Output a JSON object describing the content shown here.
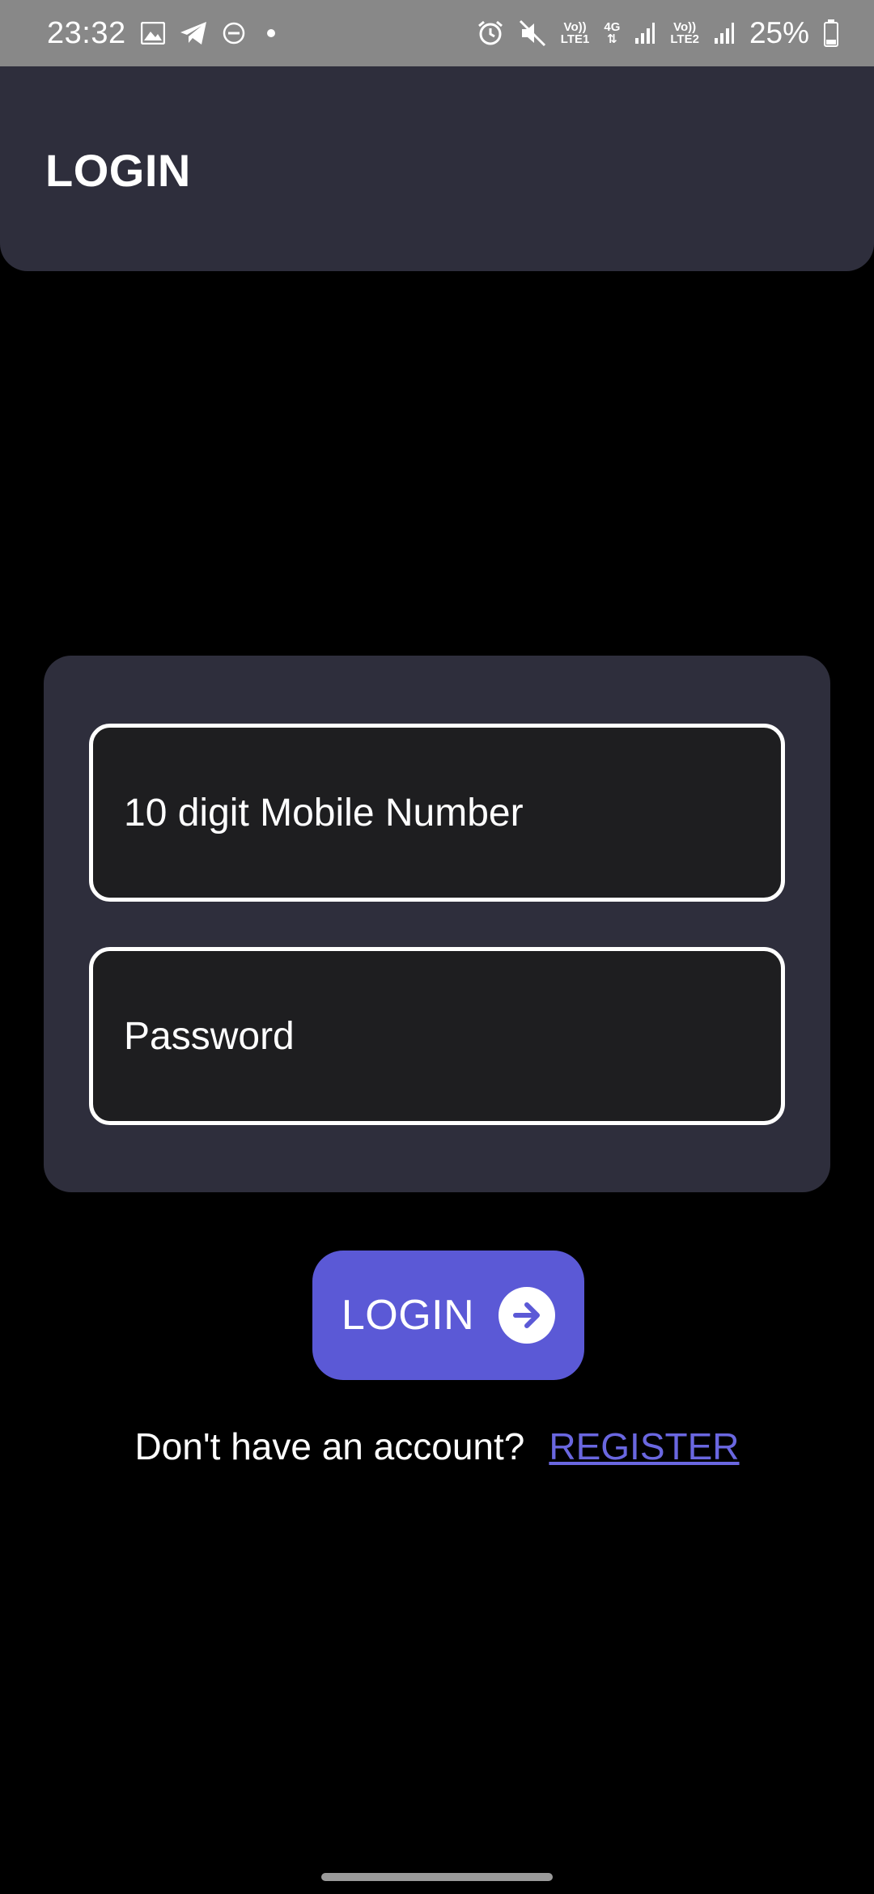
{
  "status_bar": {
    "time": "23:32",
    "battery": "25%",
    "sim1_label_top": "Vo))",
    "sim1_label_bottom": "LTE1",
    "network_type": "4G",
    "sim2_label_top": "Vo))",
    "sim2_label_bottom": "LTE2",
    "icons": [
      "image-icon",
      "telegram-icon",
      "do-not-disturb-icon",
      "notification-dot-icon",
      "alarm-icon",
      "mute-icon",
      "signal-icon",
      "battery-icon"
    ]
  },
  "app_bar": {
    "title": "LOGIN"
  },
  "form": {
    "mobile_placeholder": "10 digit Mobile Number",
    "mobile_value": "",
    "password_placeholder": "Password",
    "password_value": ""
  },
  "login_button": {
    "label": "LOGIN",
    "icon": "arrow-right-circle-icon"
  },
  "register": {
    "prompt": "Don't have an account?",
    "link_label": "REGISTER"
  },
  "colors": {
    "background": "#000000",
    "surface": "#2e2e3c",
    "field_fill": "#1e1e20",
    "accent": "#5b59d6",
    "link": "#6a67e0",
    "status_bar": "#888888"
  }
}
